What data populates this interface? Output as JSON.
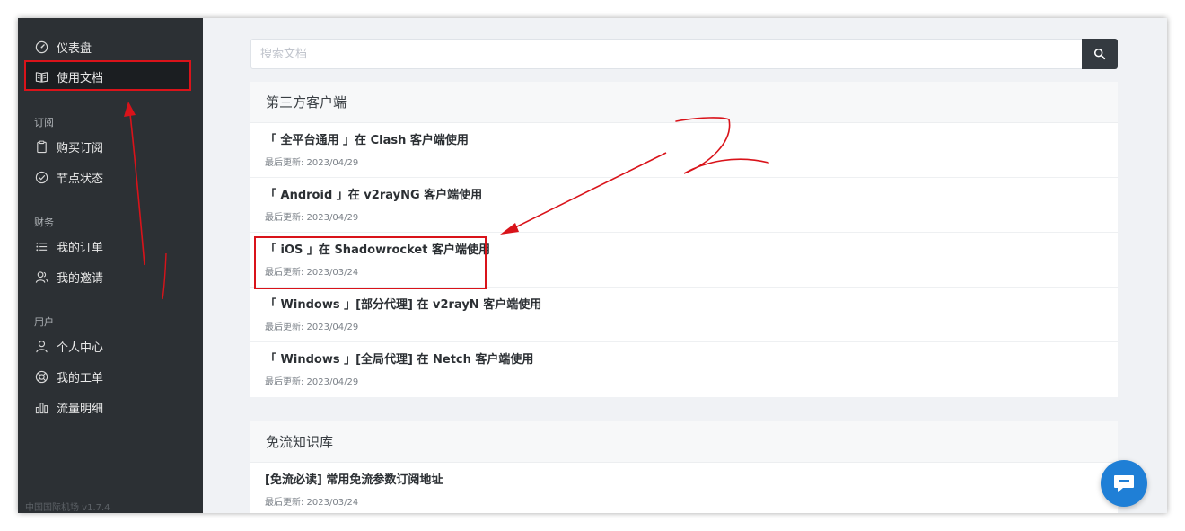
{
  "sidebar": {
    "items": [
      {
        "label": "仪表盘",
        "icon": "dashboard-icon"
      },
      {
        "label": "使用文档",
        "icon": "book-icon",
        "active": true
      }
    ],
    "sections": [
      {
        "title": "订阅",
        "items": [
          {
            "label": "购买订阅",
            "icon": "clipboard-icon"
          },
          {
            "label": "节点状态",
            "icon": "check-circle-icon"
          }
        ]
      },
      {
        "title": "财务",
        "items": [
          {
            "label": "我的订单",
            "icon": "list-icon"
          },
          {
            "label": "我的邀请",
            "icon": "users-icon"
          }
        ]
      },
      {
        "title": "用户",
        "items": [
          {
            "label": "个人中心",
            "icon": "user-icon"
          },
          {
            "label": "我的工单",
            "icon": "lifebuoy-icon"
          },
          {
            "label": "流量明细",
            "icon": "bar-chart-icon"
          }
        ]
      }
    ],
    "version": "中国国际机场 v1.7.4"
  },
  "search": {
    "placeholder": "搜索文档",
    "icon": "search-icon"
  },
  "panels": [
    {
      "title": "第三方客户端",
      "docs": [
        {
          "title": "「 全平台通用 」在 Clash 客户端使用",
          "date": "最后更新: 2023/04/29"
        },
        {
          "title": "「 Android 」在 v2rayNG 客户端使用",
          "date": "最后更新: 2023/04/29"
        },
        {
          "title": "「 iOS 」在 Shadowrocket 客户端使用",
          "date": "最后更新: 2023/03/24"
        },
        {
          "title": "「 Windows 」[部分代理] 在 v2rayN 客户端使用",
          "date": "最后更新: 2023/04/29"
        },
        {
          "title": "「 Windows 」[全局代理] 在 Netch 客户端使用",
          "date": "最后更新: 2023/04/29"
        }
      ]
    },
    {
      "title": "免流知识库",
      "docs": [
        {
          "title": "[免流必读] 常用免流参数订阅地址",
          "date": "最后更新: 2023/03/24"
        }
      ]
    }
  ],
  "chat": {
    "icon": "chat-bubble-icon"
  },
  "colors": {
    "sidebar": "#2c3034",
    "accent": "#1f7fd6",
    "annotation": "#d9131a"
  }
}
